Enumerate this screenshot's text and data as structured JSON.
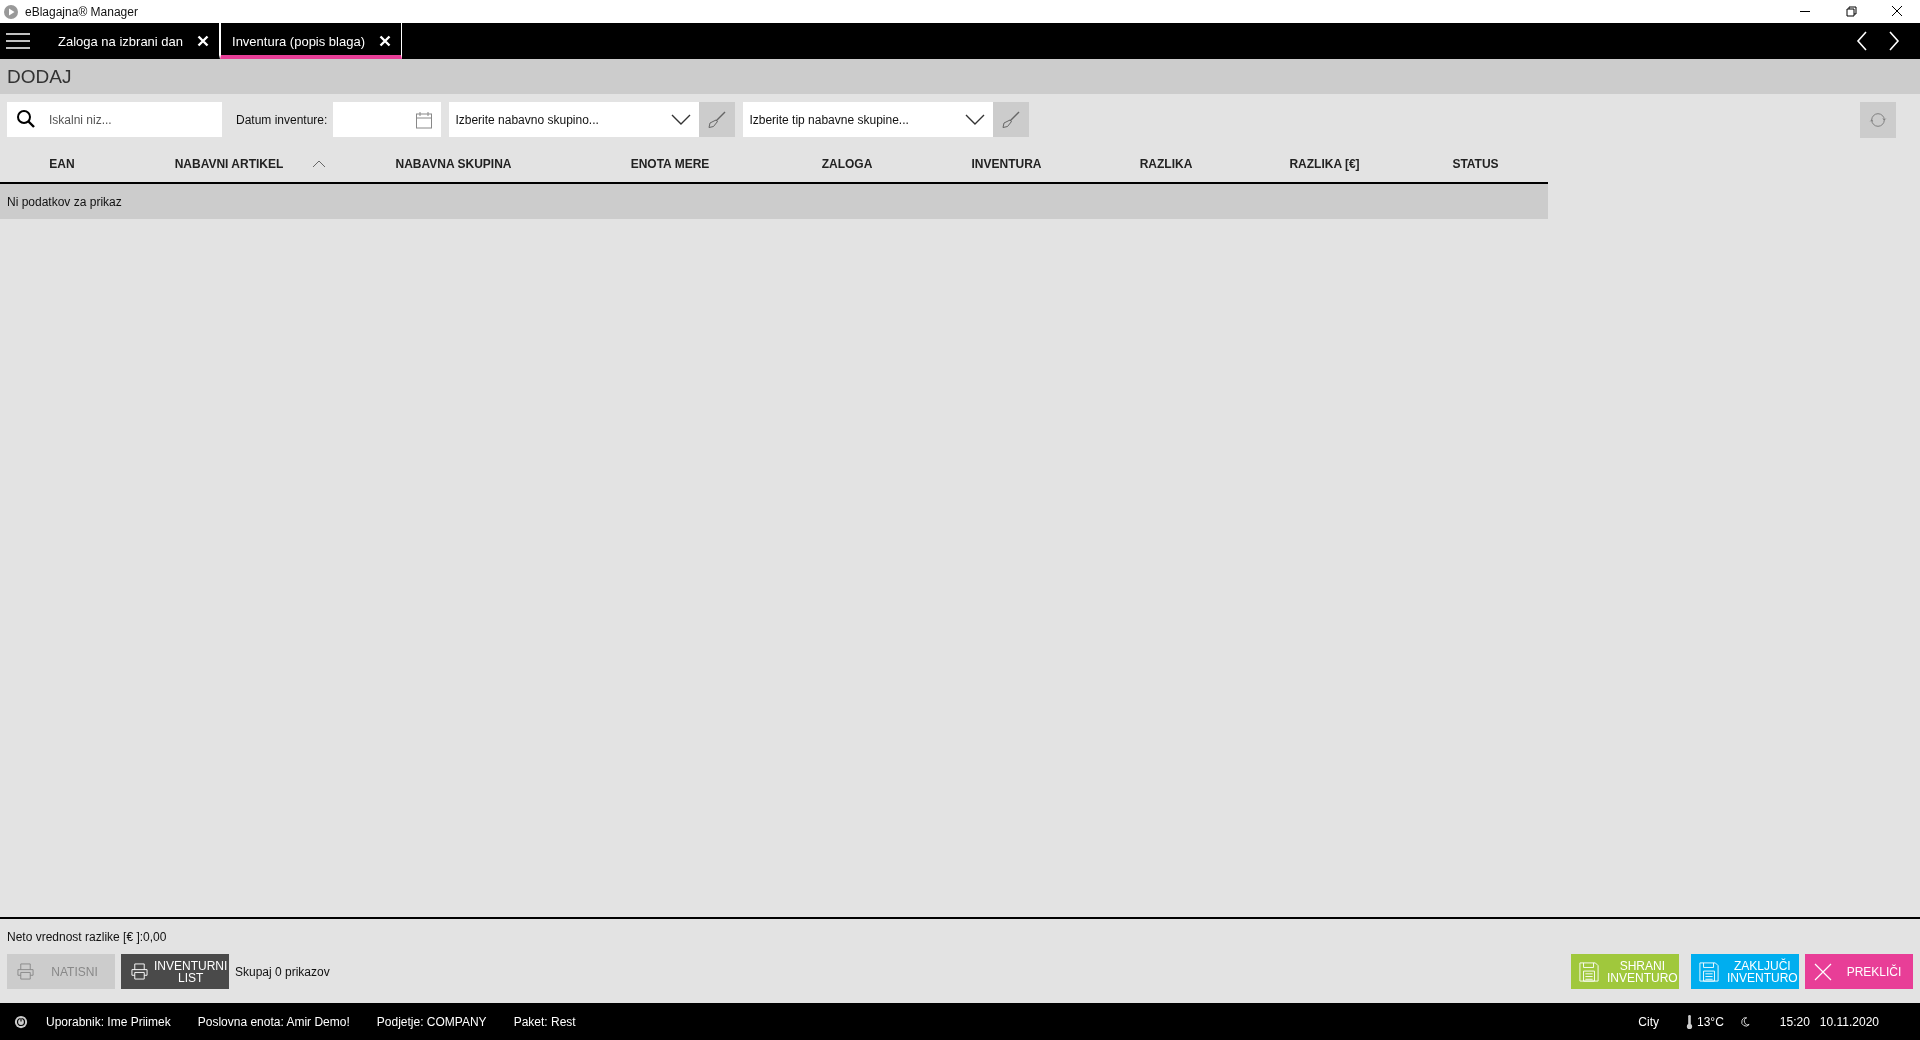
{
  "window": {
    "title": "eBlagajna® Manager"
  },
  "tabs": [
    {
      "label": "Zaloga na izbrani dan",
      "selected": false
    },
    {
      "label": "Inventura (popis blaga)",
      "selected": true
    }
  ],
  "page_title": "DODAJ",
  "filters": {
    "search": {
      "placeholder": "Iskalni niz..."
    },
    "date_label": "Datum inventure:",
    "group_dropdown": {
      "placeholder": "Izberite nabavno skupino..."
    },
    "type_dropdown": {
      "placeholder": "Izberite tip nabavne skupine..."
    }
  },
  "table": {
    "columns": [
      {
        "label": "EAN",
        "sorted": false
      },
      {
        "label": "NABAVNI ARTIKEL",
        "sorted": true
      },
      {
        "label": "NABAVNA SKUPINA",
        "sorted": false
      },
      {
        "label": "ENOTA MERE",
        "sorted": false
      },
      {
        "label": "ZALOGA",
        "sorted": false
      },
      {
        "label": "INVENTURA",
        "sorted": false
      },
      {
        "label": "RAZLIKA",
        "sorted": false
      },
      {
        "label": "RAZLIKA [€]",
        "sorted": false
      },
      {
        "label": "STATUS",
        "sorted": false
      }
    ],
    "empty_message": "Ni podatkov za prikaz"
  },
  "summary": "Neto vrednost razlike [€ ]:0,00",
  "left_buttons": [
    {
      "label": "NATISNI",
      "disabled": true
    },
    {
      "label": "INVENTURNI LIST",
      "disabled": false
    }
  ],
  "count": "Skupaj 0 prikazov",
  "right_buttons": [
    {
      "label": "SHRANI INVENTURO",
      "kind": "save",
      "color": "#a0c83c"
    },
    {
      "label": "ZAKLJUČI INVENTURO",
      "kind": "save",
      "color": "#00aeef"
    },
    {
      "label": "PREKLIČI",
      "kind": "cancel",
      "color": "#e83e97"
    }
  ],
  "status_bar": {
    "items": [
      "Uporabnik: Ime Priimek",
      "Poslovna enota: Amir Demo!",
      "Podjetje: COMPANY",
      "Paket: Rest"
    ],
    "city": "City",
    "temperature": "13°C",
    "time": "15:20",
    "date": "10.11.2020"
  }
}
